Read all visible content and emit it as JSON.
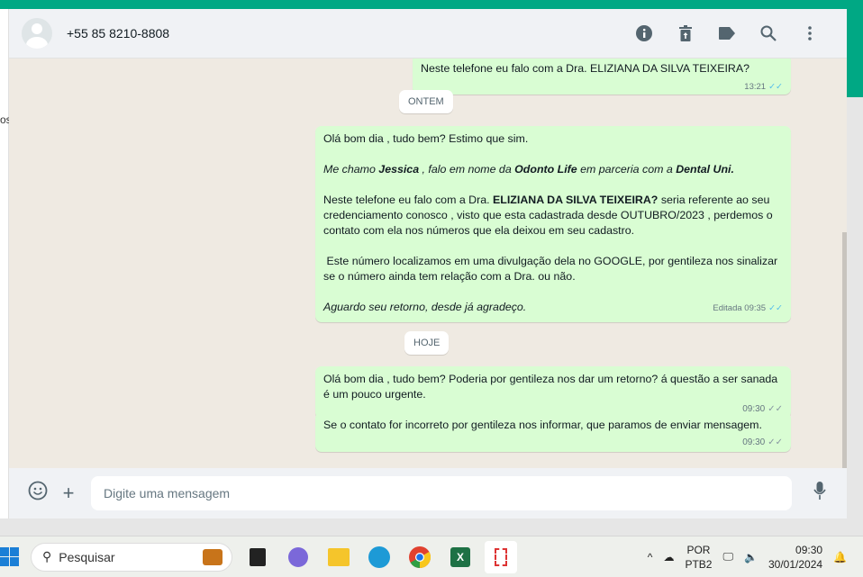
{
  "header": {
    "contact": "+55 85 8210-8808",
    "icons": [
      "info-icon",
      "trash-icon",
      "label-icon",
      "search-icon",
      "menu-icon"
    ]
  },
  "sidebar": {
    "partial_text": "os"
  },
  "messages": [
    {
      "text": "Neste telefone eu falo com a Dra. ELIZIANA DA SILVA TEIXEIRA?",
      "time": "13:21"
    },
    {
      "divider": "ONTEM"
    },
    {
      "lines": {
        "l1": "Olá bom dia , tudo bem? Estimo que sim.",
        "l2a": "Me chamo ",
        "l2b": "Jessica",
        "l2c": " , falo em nome da ",
        "l2d": "Odonto Life",
        "l2e": " em parceria com a ",
        "l2f": "Dental Uni.",
        "l3a": "Neste telefone eu falo com a Dra. ",
        "l3b": "ELIZIANA DA SILVA TEIXEIRA?",
        "l3c": " seria referente ao seu credenciamento conosco  , visto que esta cadastrada desde OUTUBRO/2023 ,  perdemos o contato com ela nos números que ela deixou em seu cadastro.",
        "l4": " Este número localizamos em uma divulgação dela no GOOGLE, por gentileza nos sinalizar se o número ainda tem relação com a Dra. ou não.",
        "l5": "Aguardo seu retorno, desde já agradeço."
      },
      "edited": "Editada",
      "time": "09:35"
    },
    {
      "divider": "HOJE"
    },
    {
      "text": "Olá bom dia , tudo bem? Poderia por gentileza nos dar um retorno? á questão a ser sanada é um pouco urgente.",
      "time": "09:30"
    },
    {
      "text": "Se o contato for incorreto por gentileza nos informar, que paramos de enviar mensagem.",
      "time": "09:30"
    }
  ],
  "composer": {
    "placeholder": "Digite uma mensagem"
  },
  "taskbar": {
    "search": "Pesquisar",
    "lang1": "POR",
    "lang2": "PTB2",
    "time": "09:30",
    "date": "30/01/2024"
  },
  "colors": {
    "accent": "#00a884",
    "bubble": "#d9fdd3",
    "chat_bg": "#efeae2"
  }
}
